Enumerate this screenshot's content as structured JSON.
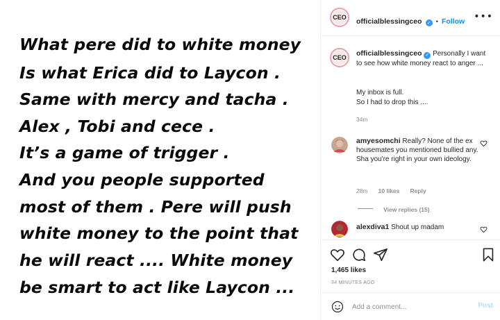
{
  "post_image": {
    "lines": [
      "What pere did to white money",
      "Is what Erica did to Laycon .",
      "Same with mercy and tacha .",
      "Alex , Tobi and cece .",
      "It’s a game of trigger .",
      "And you people supported",
      "most of them . Pere will push",
      "white money to the point that",
      "he will react .... White money",
      "be smart to act like Laycon ..."
    ]
  },
  "header": {
    "avatar_text": "CEO",
    "username": "officialblessingceo",
    "verified_icon": "verified-badge-icon",
    "separator": "•",
    "follow_label": "Follow",
    "more_icon": "more-options-icon"
  },
  "caption": {
    "avatar_text": "CEO",
    "username": "officialblessingceo",
    "text_1": "Personally I want to see how white money react to anger ...",
    "text_2": "My inbox is full.",
    "text_3": "So I had to drop this ....",
    "age": "34m"
  },
  "comments": [
    {
      "username": "amyesomchi",
      "text": "Really? None of the ex housemates you mentioned bullied any. Sha you're right in your own ideology.",
      "age": "28m",
      "likes": "10 likes",
      "reply_label": "Reply",
      "view_replies": "View replies (15)"
    },
    {
      "username": "alexdiva1",
      "text": "Shout up madam"
    }
  ],
  "actions": {
    "like_icon": "heart-icon",
    "comment_icon": "comment-icon",
    "share_icon": "share-icon",
    "save_icon": "bookmark-icon",
    "likes": "1,465 likes",
    "timestamp": "34 MINUTES AGO"
  },
  "add_comment": {
    "emoji_icon": "emoji-icon",
    "placeholder": "Add a comment...",
    "post_label": "Post"
  },
  "colors": {
    "follow_blue": "#0095f6",
    "verified_blue": "#3897f0",
    "muted_gray": "#8e8e8e",
    "post_disabled": "#b2dffc"
  }
}
